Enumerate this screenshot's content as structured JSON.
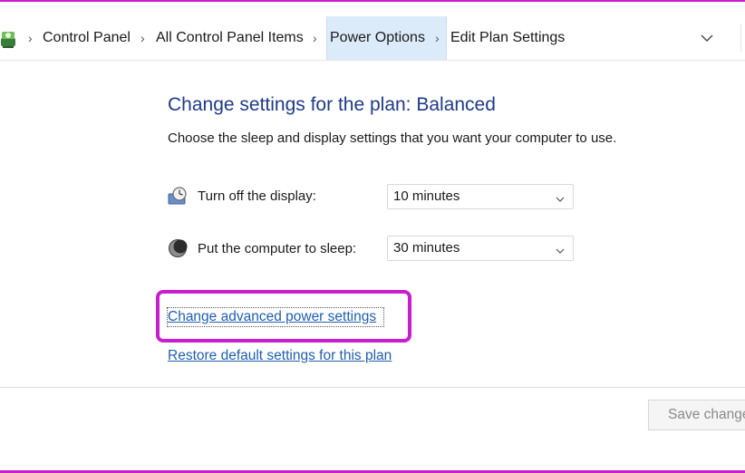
{
  "breadcrumb": {
    "items": [
      "Control Panel",
      "All Control Panel Items",
      "Power Options",
      "Edit Plan Settings"
    ],
    "separator": "›",
    "icon": "control-panel-icon",
    "dropdown_icon": "chevron-down-icon"
  },
  "main": {
    "heading": "Change settings for the plan: Balanced",
    "subtitle": "Choose the sleep and display settings that you want your computer to use.",
    "rows": [
      {
        "icon": "display-timer-icon",
        "label": "Turn off the display:",
        "value": "10 minutes"
      },
      {
        "icon": "sleep-moon-icon",
        "label": "Put the computer to sleep:",
        "value": "30 minutes"
      }
    ],
    "links": {
      "advanced": "Change advanced power settings",
      "restore": "Restore default settings for this plan"
    }
  },
  "footer": {
    "save_label": "Save changes"
  },
  "colors": {
    "annotation": "#c81ecf",
    "heading": "#1e3a8a",
    "link": "#1f5fb0",
    "breadcrumb_highlight": "#dcebfa"
  }
}
